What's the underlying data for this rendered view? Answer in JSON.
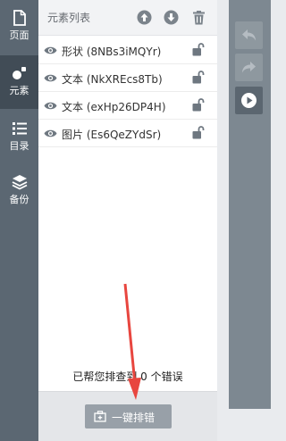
{
  "nav": {
    "items": [
      {
        "label": "页面",
        "icon": "page-icon"
      },
      {
        "label": "元素",
        "icon": "elements-icon",
        "active": true
      },
      {
        "label": "目录",
        "icon": "list-icon"
      },
      {
        "label": "备份",
        "icon": "layers-icon"
      }
    ]
  },
  "panel": {
    "title": "元素列表",
    "header_icons": [
      "move-up-icon",
      "move-down-icon",
      "trash-icon"
    ],
    "elements": [
      {
        "name": "形状 (8NBs3iMQYr)"
      },
      {
        "name": "文本 (NkXREcs8Tb)"
      },
      {
        "name": "文本 (exHp26DP4H)"
      },
      {
        "name": "图片 (Es6QeZYdSr)"
      }
    ],
    "error_message": "已帮您排查到 0 个错误",
    "fix_button": "一键排错"
  },
  "toolbar": {
    "buttons": [
      "undo-icon",
      "redo-icon",
      "play-icon"
    ]
  },
  "colors": {
    "nav_bg": "#5b6772",
    "nav_active": "#414c56",
    "tool_bg": "#7d8891",
    "arrow": "#e8463f"
  }
}
